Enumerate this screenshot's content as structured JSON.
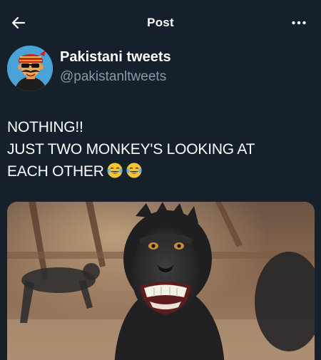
{
  "header": {
    "title": "Post",
    "back_icon": "arrow-left-icon",
    "more_icon": "more-horizontal-icon"
  },
  "author": {
    "name": "Pakistani tweets",
    "handle": "@pakistanltweets"
  },
  "tweet": {
    "lines": [
      "NOTHING!!",
      "JUST TWO MONKEY'S LOOKING AT",
      "EACH OTHER"
    ],
    "emojis": [
      "face-with-tears-of-joy",
      "face-with-tears-of-joy"
    ]
  },
  "media": {
    "subject": "smiling monkey photo"
  },
  "colors": {
    "background": "#15202b",
    "text": "#ffffff",
    "secondary_text": "#8b98a5"
  }
}
